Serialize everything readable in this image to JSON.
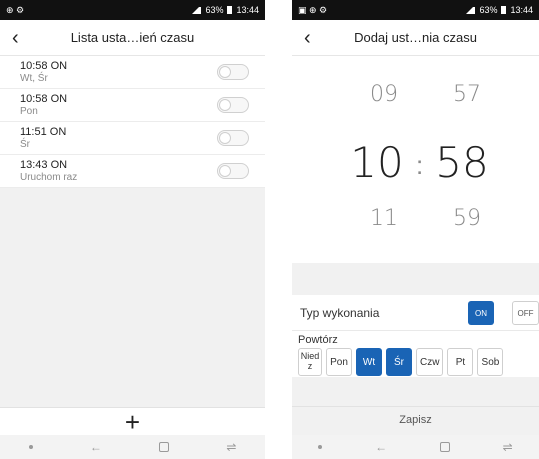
{
  "left_screen": {
    "status": {
      "left_icons": "⊕ ⚙",
      "right_text": "63%",
      "time": "13:44"
    },
    "title": "Lista usta…ień czasu",
    "back_label": "‹",
    "rows": [
      {
        "time": "10:58  ON",
        "sub": "Wt, Śr"
      },
      {
        "time": "10:58  ON",
        "sub": "Pon"
      },
      {
        "time": "11:51  ON",
        "sub": "Śr"
      },
      {
        "time": "13:43  ON",
        "sub": "Uruchom raz"
      }
    ],
    "add_label": "+",
    "nav": {
      "back": "←",
      "recent": "⇌"
    }
  },
  "right_screen": {
    "status": {
      "left_icons": "▣ ⊕ ⚙",
      "right_text": "63%",
      "time": "13:44"
    },
    "title": "Dodaj ust…nia czasu",
    "back_label": "‹",
    "picker": {
      "hour_prev": "09",
      "minute_prev": "57",
      "hour": "10",
      "minute": "58",
      "separator": ":",
      "hour_next": "11",
      "minute_next": "59"
    },
    "type_label": "Typ wykonania",
    "on_label": "ON",
    "off_label": "OFF",
    "repeat_label": "Powtórz",
    "days": [
      {
        "label": "Nied z",
        "selected": false
      },
      {
        "label": "Pon",
        "selected": false
      },
      {
        "label": "Wt",
        "selected": true
      },
      {
        "label": "Śr",
        "selected": true
      },
      {
        "label": "Czw",
        "selected": false
      },
      {
        "label": "Pt",
        "selected": false
      },
      {
        "label": "Sob",
        "selected": false
      }
    ],
    "save_label": "Zapisz",
    "nav": {
      "back": "←",
      "recent": "⇌"
    }
  },
  "colors": {
    "accent": "#1a64b5",
    "status_bar": "#111111",
    "background": "#f1f1f1"
  }
}
